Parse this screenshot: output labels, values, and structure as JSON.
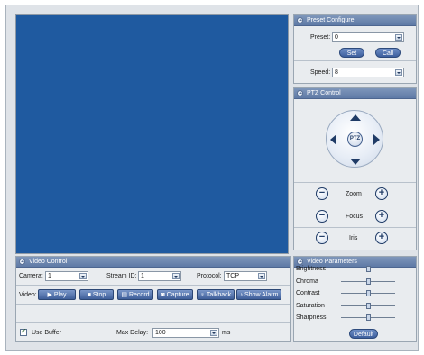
{
  "preset": {
    "title": "Preset Configure",
    "preset_label": "Preset:",
    "preset_value": "0",
    "set_label": "Set",
    "call_label": "Call",
    "speed_label": "Speed:",
    "speed_value": "8"
  },
  "ptz": {
    "title": "PTZ Control",
    "center_label": "PTZ",
    "zoom_label": "Zoom",
    "focus_label": "Focus",
    "iris_label": "Iris",
    "minus_symbol": "−",
    "plus_symbol": "+"
  },
  "video_control": {
    "title": "Video Control",
    "camera_label": "Camera:",
    "camera_value": "1",
    "stream_label": "Stream ID:",
    "stream_value": "1",
    "protocol_label": "Protocol:",
    "protocol_value": "TCP",
    "video_label": "Video:",
    "buttons": {
      "play": "Play",
      "stop": "Stop",
      "record": "Record",
      "capture": "Capture",
      "talkback": "Talkback",
      "alarm": "Show Alarm"
    },
    "use_buffer_label": "Use Buffer",
    "use_buffer_checked": true,
    "max_delay_label": "Max Delay:",
    "max_delay_value": "100",
    "ms_label": "ms"
  },
  "video_params": {
    "title": "Video Parameters",
    "params": [
      {
        "name": "Brightness",
        "level": 0.5
      },
      {
        "name": "Chroma",
        "level": 0.5
      },
      {
        "name": "Contrast",
        "level": 0.5
      },
      {
        "name": "Saturation",
        "level": 0.5
      },
      {
        "name": "Sharpness",
        "level": 0.5
      }
    ],
    "default_label": "Default"
  },
  "colors": {
    "video_bg": "#1f5aa0",
    "header": "#6b84ae",
    "button": "#4f6fa9"
  }
}
